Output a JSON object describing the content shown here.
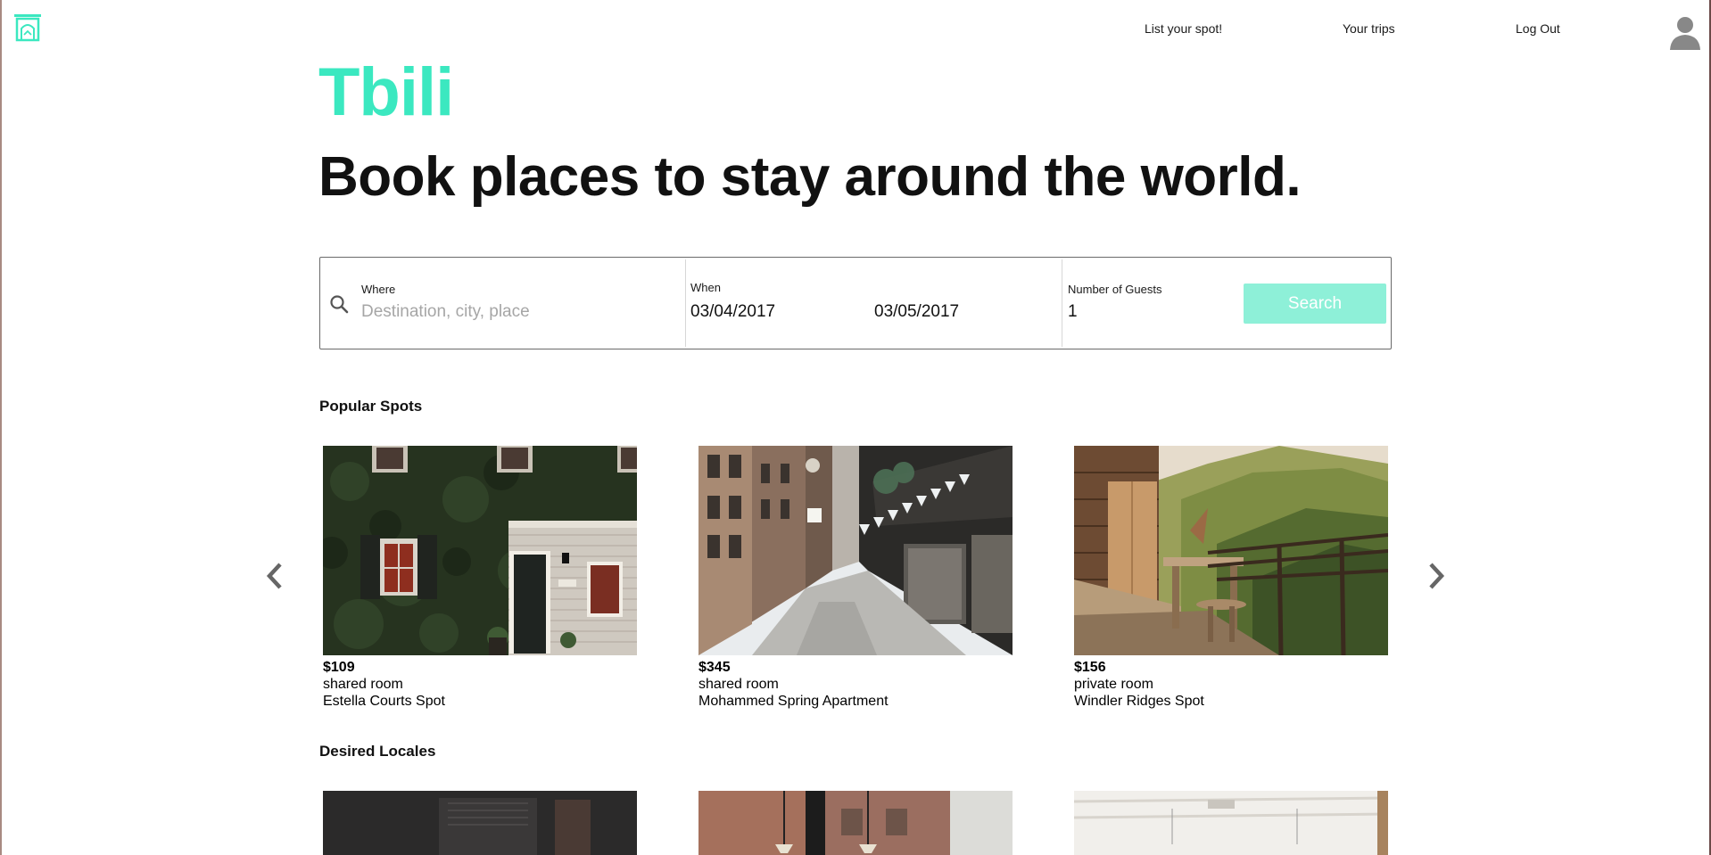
{
  "header": {
    "logo_icon": "house-logo-icon",
    "nav": {
      "list_spot": "List your spot!",
      "your_trips": "Your trips",
      "log_out": "Log Out"
    },
    "avatar_icon": "user-avatar-icon"
  },
  "hero": {
    "brand": "Tbili",
    "headline": "Book places to stay around the world."
  },
  "search": {
    "where_label": "Where",
    "where_placeholder": "Destination, city, place",
    "when_label": "When",
    "check_in": "03/04/2017",
    "check_out": "03/05/2017",
    "guests_label": "Number of Guests",
    "guests_value": "1",
    "button_label": "Search"
  },
  "popular": {
    "title": "Popular Spots",
    "listings": [
      {
        "price": "$109",
        "room_type": "shared room",
        "name": "Estella Courts Spot"
      },
      {
        "price": "$345",
        "room_type": "shared room",
        "name": "Mohammed Spring Apartment"
      },
      {
        "price": "$156",
        "room_type": "private room",
        "name": "Windler Ridges Spot"
      }
    ]
  },
  "desired": {
    "title": "Desired Locales"
  },
  "colors": {
    "brand": "#3be8c0",
    "search_button": "#8ef0d8"
  }
}
